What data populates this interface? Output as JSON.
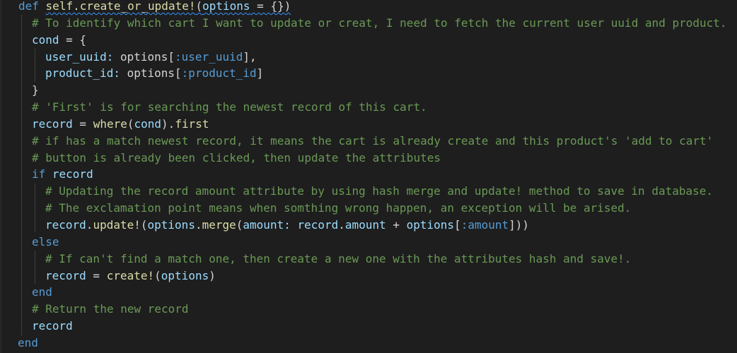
{
  "editor": {
    "language": "ruby",
    "theme_colors": {
      "background": "#1e1e1e",
      "keyword": "#569cd6",
      "function": "#dcdcaa",
      "identifier": "#9cdcfe",
      "symbol": "#569cd6",
      "comment": "#6a9955",
      "plain": "#d4d4d4",
      "error_squiggle": "#3794ff"
    },
    "lines": {
      "l1": {
        "kw_def": "def",
        "name": "self.create_or_update!",
        "open": "(",
        "param": "options",
        "rest": " = {})"
      },
      "l2": {
        "comment": "# To identify which cart I want to update or creat, I need to fetch the current user uuid and product."
      },
      "l3": {
        "var": "cond",
        "rest": " = {"
      },
      "l4": {
        "key": "user_uuid:",
        "recv": " options[",
        "sym": ":user_uuid",
        "close": "],"
      },
      "l5": {
        "key": "product_id:",
        "recv": " options[",
        "sym": ":product_id",
        "close": "]"
      },
      "l6": {
        "text": "}"
      },
      "l7": {
        "comment": "# 'First' is for searching the newest record of this cart."
      },
      "l8": {
        "var": "record",
        "eq": " = ",
        "fn": "where",
        "paren_open": "(",
        "arg": "cond",
        "paren_close": ").",
        "method": "first"
      },
      "l9": {
        "comment": "# if has a match newest record, it means the cart is already create and this product's 'add to cart'"
      },
      "l10": {
        "comment": "# button is already been clicked, then update the attributes"
      },
      "l11": {
        "kw": "if",
        "var": " record"
      },
      "l12": {
        "comment": "# Updating the record amount attribute by using hash merge and update! method to save in database."
      },
      "l13": {
        "comment": "# The exclamation point means when somthing wrong happen, an exception will be arised."
      },
      "l14": {
        "recv": "record",
        "dot1": ".",
        "m1": "update!",
        "p1": "(",
        "opts": "options",
        "dot2": ".",
        "m2": "merge",
        "p2": "(",
        "key": "amount:",
        "space": " ",
        "rec2": "record",
        "dot3": ".",
        "attr": "amount",
        "plus": " + ",
        "opts2": "options",
        "br_open": "[",
        "sym": ":amount",
        "br_close": "]))"
      },
      "l15": {
        "kw": "else"
      },
      "l16": {
        "comment": "# If can't find a match one, then create a new one with the attributes hash and save!."
      },
      "l17": {
        "var": "record",
        "eq": " = ",
        "fn": "create!",
        "p_open": "(",
        "arg": "options",
        "p_close": ")"
      },
      "l18": {
        "kw": "end"
      },
      "l19": {
        "comment": "# Return the new record"
      },
      "l20": {
        "var": "record"
      },
      "l21": {
        "kw": "end"
      }
    }
  }
}
